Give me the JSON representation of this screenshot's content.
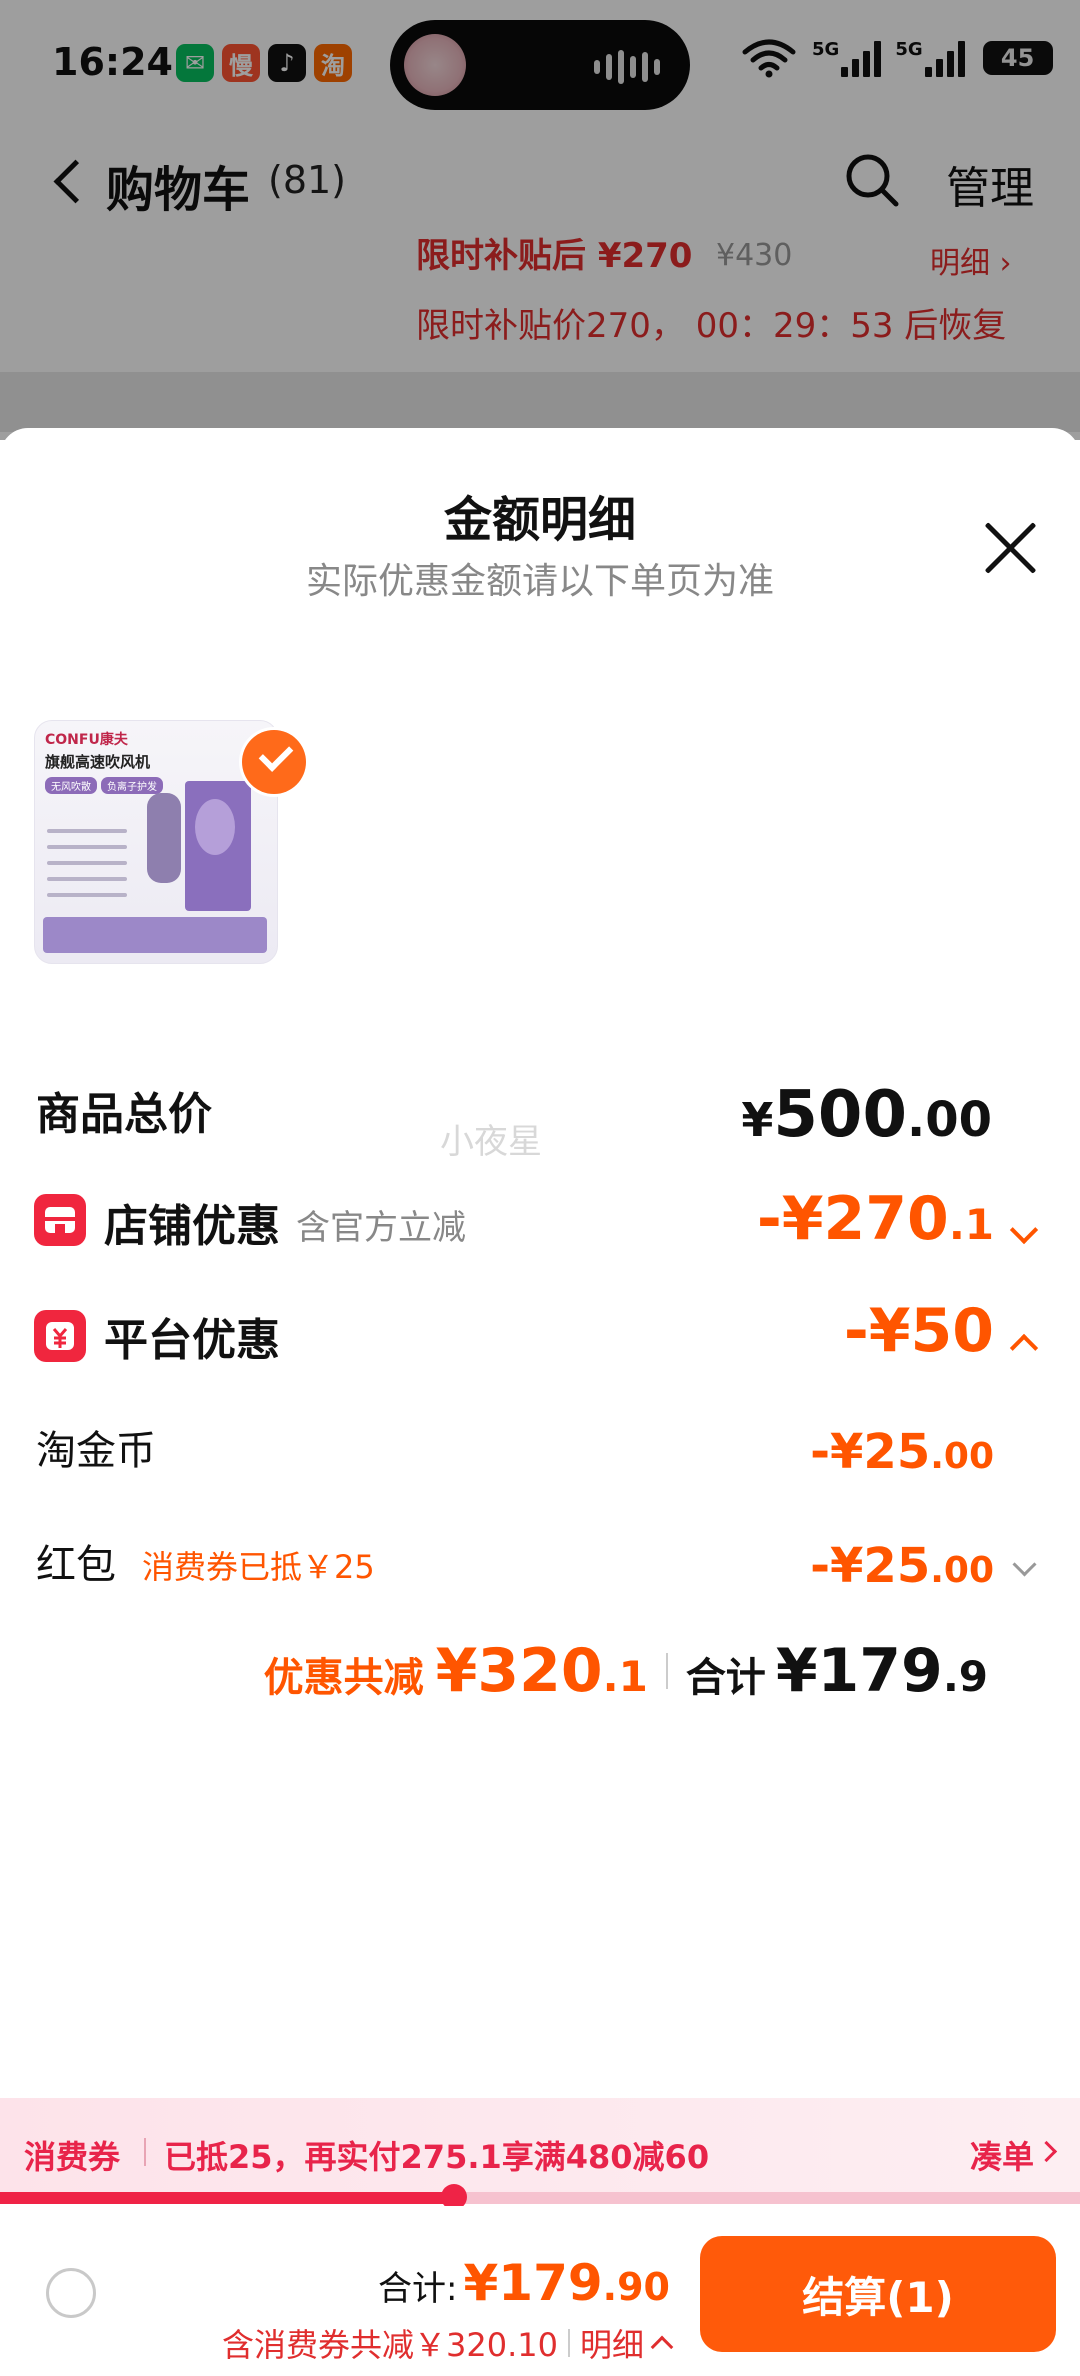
{
  "status_bar": {
    "time": "16:24",
    "apps": [
      {
        "name": "wechat-icon",
        "glyph": "✉",
        "color": "#07c160"
      },
      {
        "name": "slow-app-icon",
        "glyph": "慢",
        "color": "#ff5533"
      },
      {
        "name": "tiktok-icon",
        "glyph": "♪",
        "color": "#111111"
      },
      {
        "name": "taobao-icon",
        "glyph": "淘",
        "color": "#ff6a00"
      }
    ],
    "signal1": "5G",
    "signal2": "5G",
    "battery": "45"
  },
  "nav": {
    "title": "购物车",
    "count": "(81)",
    "manage": "管理"
  },
  "bg_item": {
    "subsidy_price": "限时补贴后 ¥270",
    "old_price": "¥430",
    "detail_link": "明细",
    "countdown_text": "限时补贴价270， 00：29：53 后恢复"
  },
  "sheet": {
    "title": "金额明细",
    "subtitle": "实际优惠金额请以下单页为准",
    "product_image": {
      "brand": "CONFU康夫",
      "name": "旗舰高速吹风机",
      "chips": [
        "无风吹散",
        "负离子护发"
      ]
    },
    "watermark": "小夜星",
    "rows": {
      "total": {
        "label": "商品总价",
        "currency": "¥",
        "int": "500",
        "dec": ".00"
      },
      "store": {
        "label": "店铺优惠",
        "note": "含官方立减",
        "int": "-¥270",
        "dec": ".1"
      },
      "platform": {
        "label": "平台优惠",
        "int": "-¥50",
        "dec": ""
      },
      "gold": {
        "label": "淘金币",
        "int": "-¥25",
        "dec": ".00"
      },
      "redpacket": {
        "label": "红包",
        "note": "消费券已抵￥25",
        "int": "-¥25",
        "dec": ".00"
      }
    },
    "summary": {
      "discount_label": "优惠共减",
      "discount_int": "¥320",
      "discount_dec": ".1",
      "sum_label": "合计",
      "sum_int": "¥179",
      "sum_dec": ".9"
    }
  },
  "coupon_bar": {
    "label": "消费券",
    "text": "已抵25，再实付275.1享满480减60",
    "link": "凑单",
    "progress": 0.42
  },
  "bottom_bar": {
    "total_label": "合计:",
    "total_int": "¥179",
    "total_dec": ".90",
    "sub_text": "含消费券共减￥320.10",
    "detail": "明细",
    "checkout": "结算(1)"
  },
  "colors": {
    "accent_orange": "#ff5500",
    "coupon_red": "#e8244a",
    "icon_red": "#f0263e"
  }
}
